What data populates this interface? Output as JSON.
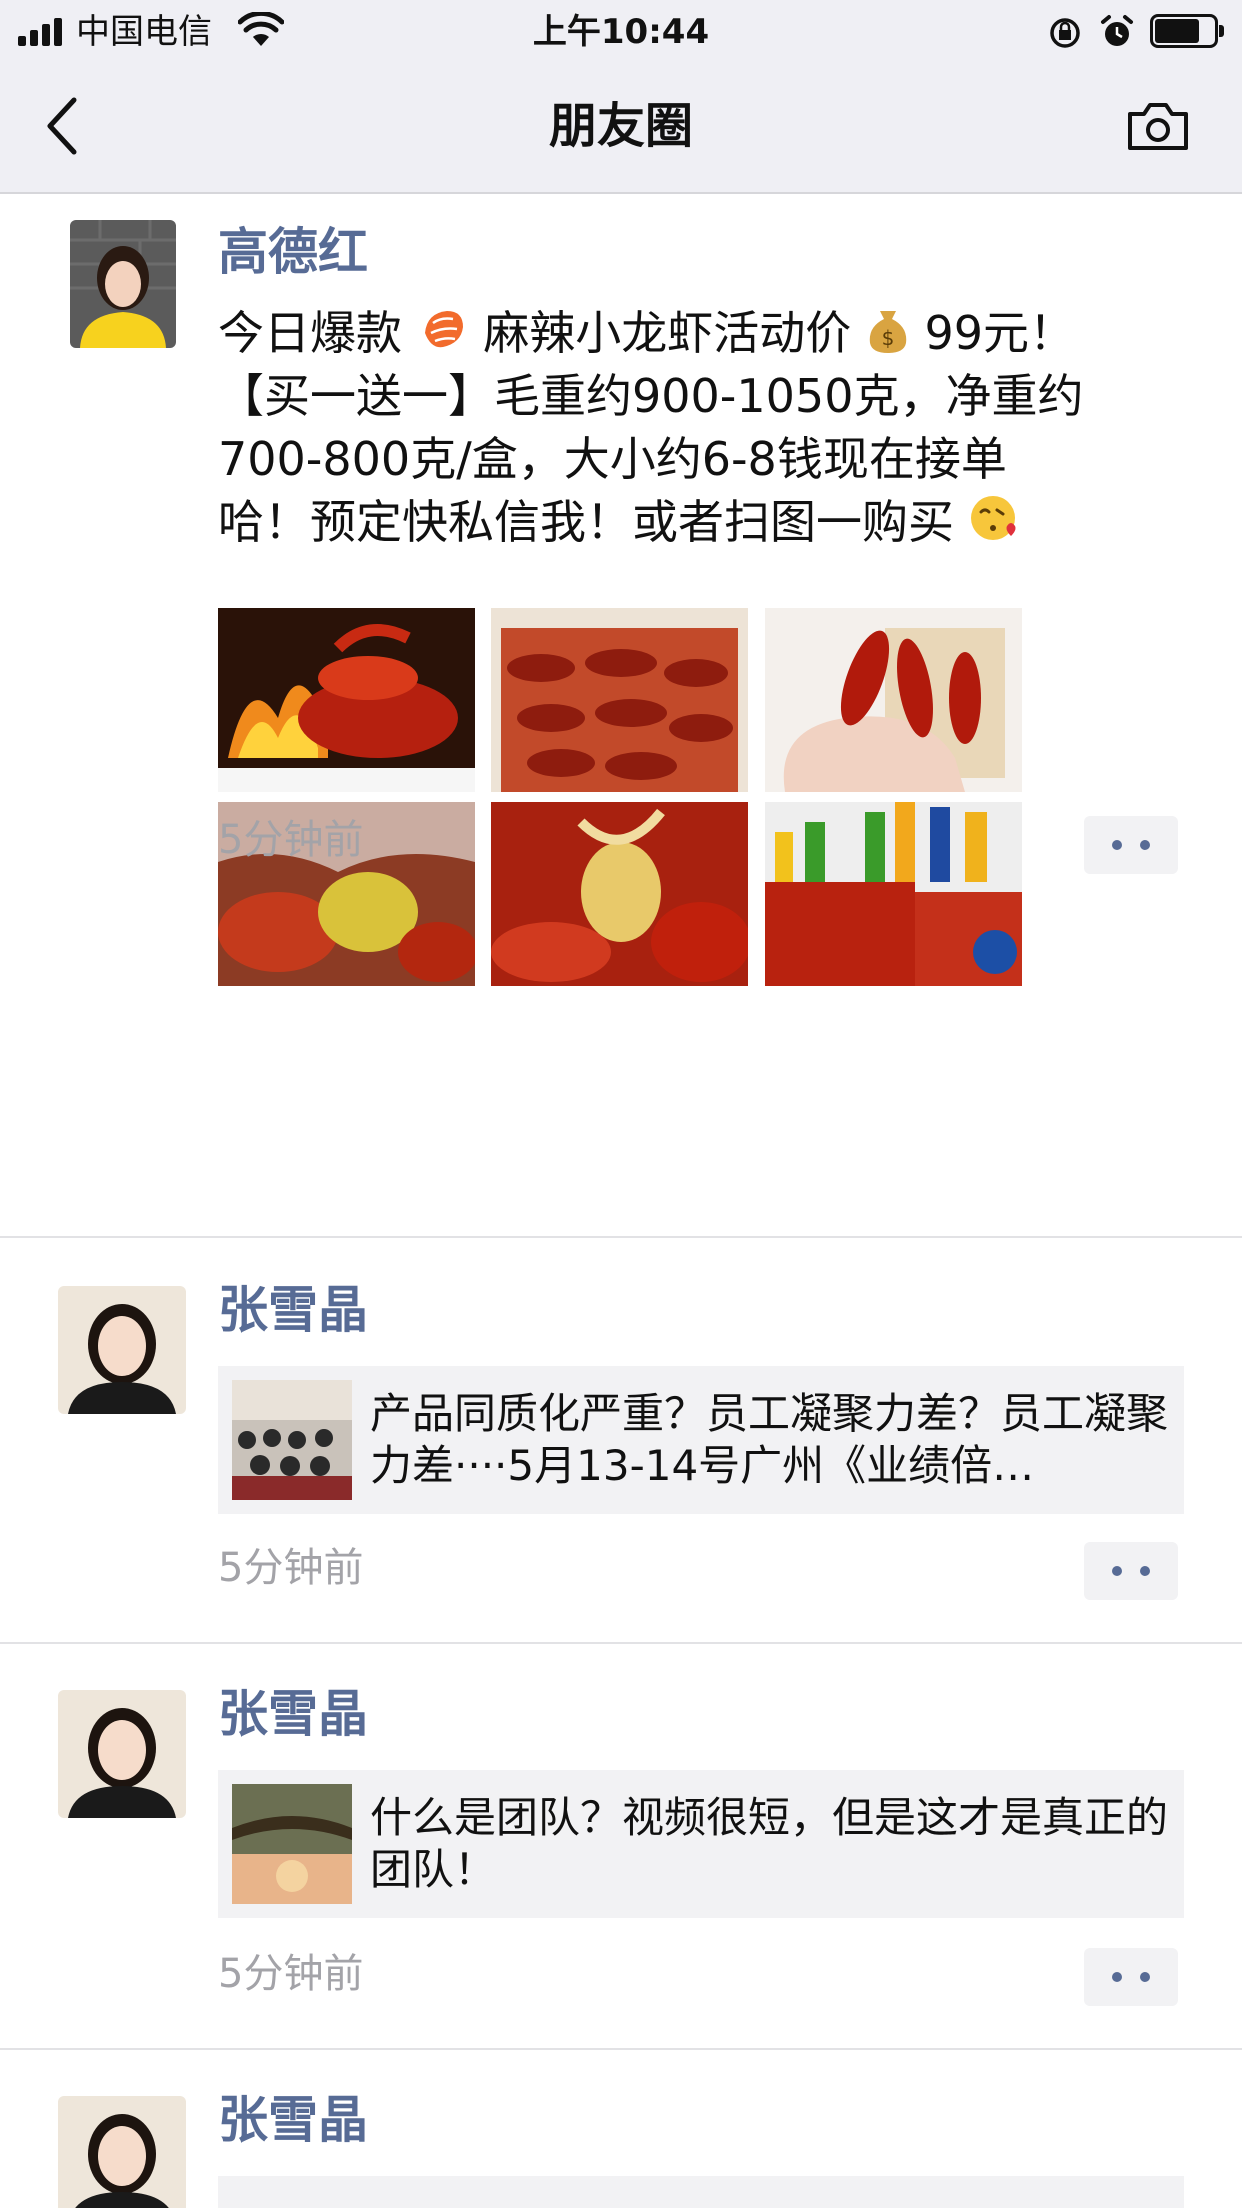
{
  "status_bar": {
    "carrier": "中国电信",
    "time": "上午10:44"
  },
  "nav": {
    "title": "朋友圈",
    "back_icon": "chevron-left-icon",
    "camera_icon": "camera-icon"
  },
  "posts": [
    {
      "author": "高德红",
      "text_lines": [
        "今日爆款",
        " 麻辣小龙虾活动价",
        "99元！",
        "【买一送一】毛重约900-1050克，净重约",
        "700-800克/盒，大小约6-8钱现在接单",
        "哈！预定快私信我！或者扫图一购买"
      ],
      "emojis": [
        "shrimp-emoji",
        "money-bag-emoji",
        "kissing-face-emoji"
      ],
      "images": [
        "crayfish-fire-photo",
        "crayfish-box-photo",
        "crayfish-hand-photo",
        "crayfish-bag-photo",
        "crayfish-closeup-photo",
        "crayfish-drinks-photo"
      ],
      "time": "5分钟前"
    },
    {
      "author": "张雪晶",
      "share_text": "产品同质化严重？员工凝聚力差？员工凝聚力差····5月13-14号广州《业绩倍…",
      "time": "5分钟前"
    },
    {
      "author": "张雪晶",
      "share_text": "什么是团队？视频很短，但是这才是真正的团队！",
      "time": "5分钟前"
    },
    {
      "author": "张雪晶"
    }
  ],
  "colors": {
    "link_blue": "#576b95",
    "bar_bg": "#efeff4",
    "share_bg": "#f2f2f4",
    "time_gray": "#a3a3a8"
  }
}
